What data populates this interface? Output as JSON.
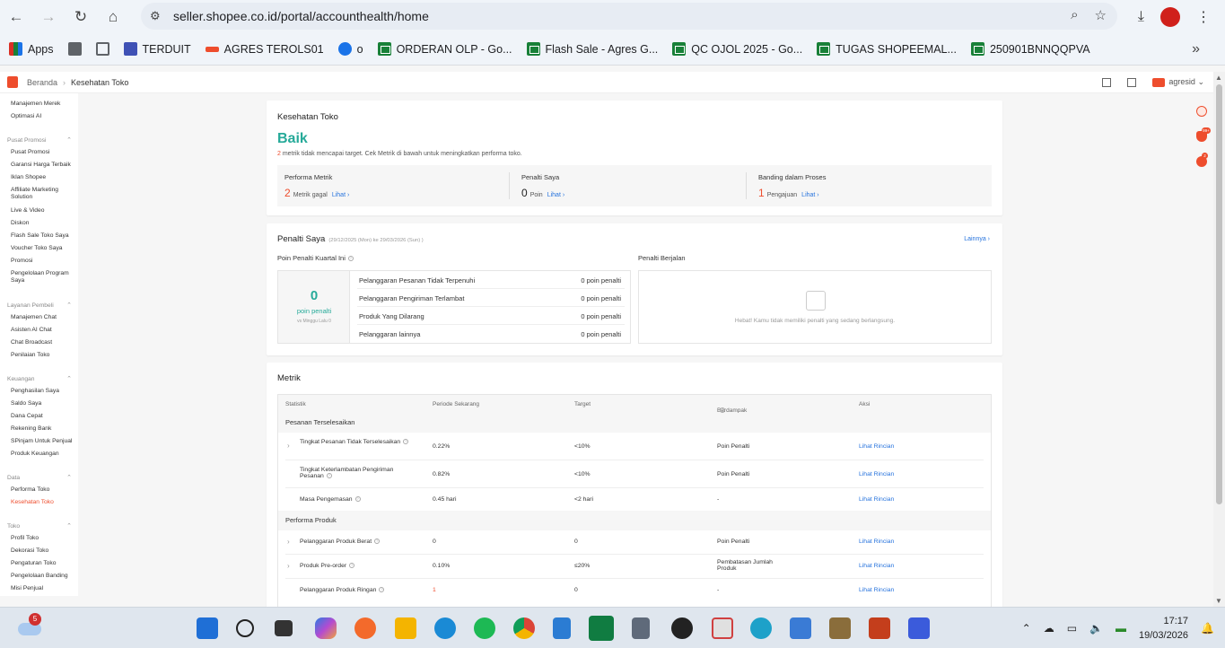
{
  "browser": {
    "url": "seller.shopee.co.id/portal/accounthealth/home",
    "bookmarks": [
      "Apps",
      "TERDUIT",
      "AGRES TEROLS01",
      "o",
      "ORDERAN OLP - Go...",
      "Flash Sale - Agres G...",
      "QC OJOL 2025 - Go...",
      "TUGAS SHOPEEMAL...",
      "250901BNNQQPVA"
    ]
  },
  "topbar": {
    "crumb_home": "Beranda",
    "crumb_current": "Kesehatan Toko",
    "user": "agresid"
  },
  "sidebar": {
    "top_items": [
      "Manajemen Merek",
      "Optimasi AI"
    ],
    "groups": [
      {
        "title": "Pusat Promosi",
        "items": [
          "Pusat Promosi",
          "Garansi Harga Terbaik",
          "Iklan Shopee",
          "Affiliate Marketing Solution",
          "Live & Video",
          "Diskon",
          "Flash Sale Toko Saya",
          "Voucher Toko Saya",
          "Promosi",
          "Pengelolaan Program Saya"
        ]
      },
      {
        "title": "Layanan Pembeli",
        "items": [
          "Manajemen Chat",
          "Asisten AI Chat",
          "Chat Broadcast",
          "Penilaian Toko"
        ]
      },
      {
        "title": "Keuangan",
        "items": [
          "Penghasilan Saya",
          "Saldo Saya",
          "Dana Cepat",
          "Rekening Bank",
          "SPinjam Untuk Penjual",
          "Produk Keuangan"
        ]
      },
      {
        "title": "Data",
        "items": [
          "Performa Toko",
          "Kesehatan Toko"
        ]
      },
      {
        "title": "Toko",
        "items": [
          "Profil Toko",
          "Dekorasi Toko",
          "Pengaturan Toko",
          "Pengelolaan Banding",
          "Misi Penjual"
        ]
      }
    ]
  },
  "health": {
    "title": "Kesehatan Toko",
    "status": "Baik",
    "desc_count": "2",
    "desc_text": " metrik tidak mencapai target. Cek Metrik di bawah untuk meningkatkan performa toko.",
    "summary": [
      {
        "label": "Performa Metrik",
        "value": "2",
        "unit": "Metrik gagal",
        "link": "Lihat ›"
      },
      {
        "label": "Penalti Saya",
        "value": "0",
        "unit": "Poin",
        "link": "Lihat ›"
      },
      {
        "label": "Banding dalam Proses",
        "value": "1",
        "unit": "Pengajuan",
        "link": "Lihat ›"
      }
    ]
  },
  "penalty": {
    "title": "Penalti Saya",
    "period": "(29/12/2025 (Mon) ke 29/03/2026 (Sun) )",
    "more": "Lainnya ›",
    "quarter_label": "Poin Penalti Kuartal Ini",
    "points": "0",
    "points_label": "poin penalti",
    "points_note": "vs Minggu Lalu 0",
    "rows": [
      {
        "name": "Pelanggaran Pesanan Tidak Terpenuhi",
        "points": "0 poin penalti"
      },
      {
        "name": "Pelanggaran Pengiriman Terlambat",
        "points": "0 poin penalti"
      },
      {
        "name": "Produk Yang Dilarang",
        "points": "0 poin penalti"
      },
      {
        "name": "Pelanggaran lainnya",
        "points": "0 poin penalti"
      }
    ],
    "running_label": "Penalti Berjalan",
    "running_msg": "Hebat! Kamu tidak memiliki penalti yang sedang berlangsung."
  },
  "metrics": {
    "title": "Metrik",
    "headers": [
      "Statistik",
      "Periode Sekarang",
      "Target",
      "Berdampak pada",
      "Aksi"
    ],
    "sections": [
      {
        "title": "Pesanan Terselesaikan",
        "rows": [
          {
            "name": "Tingkat Pesanan Tidak Terselesaikan",
            "current": "0.22%",
            "target": "<10%",
            "impact": "Poin Penalti",
            "action": "Lihat Rincian"
          },
          {
            "name": "Tingkat Keterlambatan Pengiriman Pesanan",
            "current": "0.82%",
            "target": "<10%",
            "impact": "Poin Penalti",
            "action": "Lihat Rincian"
          },
          {
            "name": "Masa Pengemasan",
            "current": "0.45 hari",
            "target": "<2 hari",
            "impact": "-",
            "action": "Lihat Rincian"
          }
        ]
      },
      {
        "title": "Performa Produk",
        "rows": [
          {
            "name": "Pelanggaran Produk Berat",
            "current": "0",
            "target": "0",
            "impact": "Poin Penalti",
            "action": "Lihat Rincian"
          },
          {
            "name": "Produk Pre-order",
            "current": "0.10%",
            "target": "≤20%",
            "impact": "Pembatasan Jumlah Produk",
            "action": "Lihat Rincian"
          },
          {
            "name": "Pelanggaran Produk Ringan",
            "current": "1",
            "target": "0",
            "impact": "-",
            "action": "Lihat Rincian"
          }
        ]
      }
    ]
  },
  "taskbar": {
    "weather_badge": "5",
    "time": "17:17",
    "date": "19/03/2026"
  },
  "floating": {
    "bell_badge": "99+",
    "chat_badge": "2"
  }
}
